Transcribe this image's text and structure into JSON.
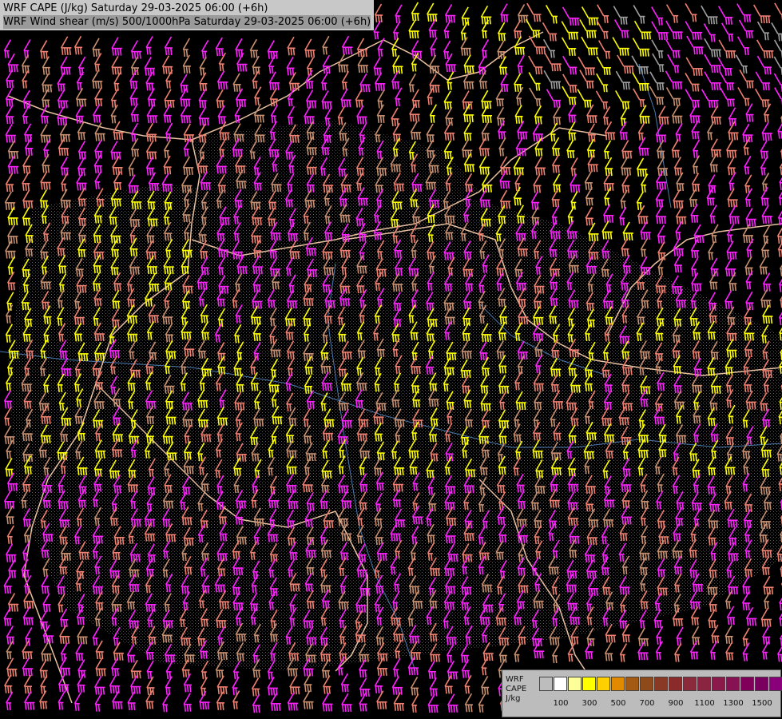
{
  "header": {
    "line1": "WRF CAPE (J/kg) Saturday 29-03-2025 06:00 (+6h)",
    "line2": "WRF Wind shear (m/s) 500/1000hPa Saturday 29-03-2025 06:00 (+6h)"
  },
  "legend": {
    "label_lines": [
      "WRF",
      "CAPE",
      "J/kg"
    ],
    "ticks": [
      "100",
      "300",
      "500",
      "700",
      "900",
      "1100",
      "1300",
      "1500"
    ],
    "colors": [
      "#bdbdbd",
      "#ffffff",
      "#ffff9a",
      "#ffff00",
      "#ffd000",
      "#e08a00",
      "#a45a12",
      "#8f4a1a",
      "#8a3a24",
      "#8a2a2a",
      "#8a2a3a",
      "#8a2440",
      "#8a1a4a",
      "#861254",
      "#80005a",
      "#7a0060",
      "#8a007a"
    ]
  },
  "barb_colors": {
    "yellow": "#ffff00",
    "magenta": "#ff22ff",
    "salmon": "#f08070",
    "tan": "#c89070",
    "grey": "#a0a0a0",
    "border": "#e8c0a0",
    "river": "#4a7ab0"
  }
}
